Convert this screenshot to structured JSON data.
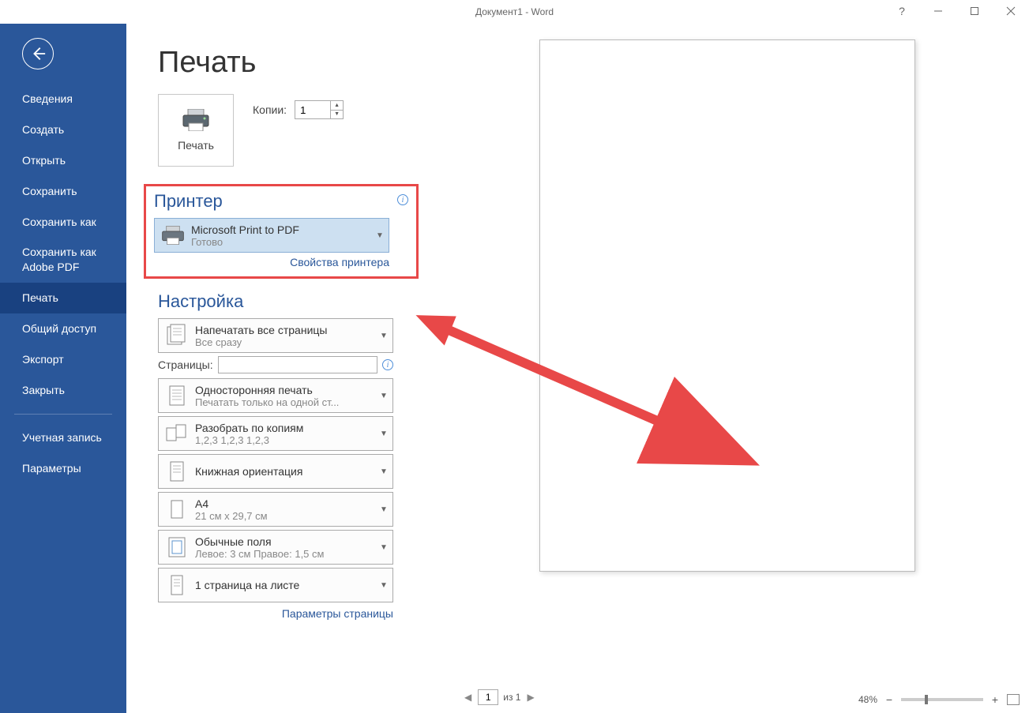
{
  "titlebar": {
    "title": "Документ1 - Word",
    "help": "?"
  },
  "sidebar": {
    "items": [
      {
        "label": "Сведения"
      },
      {
        "label": "Создать"
      },
      {
        "label": "Открыть"
      },
      {
        "label": "Сохранить"
      },
      {
        "label": "Сохранить как"
      },
      {
        "label": "Сохранить как Adobe PDF"
      },
      {
        "label": "Печать"
      },
      {
        "label": "Общий доступ"
      },
      {
        "label": "Экспорт"
      },
      {
        "label": "Закрыть"
      }
    ],
    "items2": [
      {
        "label": "Учетная запись"
      },
      {
        "label": "Параметры"
      }
    ]
  },
  "print": {
    "page_title": "Печать",
    "print_button": "Печать",
    "copies_label": "Копии:",
    "copies_value": "1",
    "printer_section": "Принтер",
    "printer": {
      "name": "Microsoft Print to PDF",
      "status": "Готово"
    },
    "printer_properties": "Свойства принтера",
    "settings_section": "Настройка",
    "settings": [
      {
        "title": "Напечатать все страницы",
        "sub": "Все сразу"
      },
      {
        "title": "Односторонняя печать",
        "sub": "Печатать только на одной ст..."
      },
      {
        "title": "Разобрать по копиям",
        "sub": "1,2,3    1,2,3    1,2,3"
      },
      {
        "title": "Книжная ориентация",
        "sub": ""
      },
      {
        "title": "A4",
        "sub": "21 см x 29,7 см"
      },
      {
        "title": "Обычные поля",
        "sub": "Левое:  3 см    Правое:  1,5 см"
      },
      {
        "title": "1 страница на листе",
        "sub": ""
      }
    ],
    "pages_label": "Страницы:",
    "pages_value": "",
    "page_setup": "Параметры страницы"
  },
  "nav": {
    "current": "1",
    "of_text": "из 1"
  },
  "zoom": {
    "percent": "48%"
  }
}
